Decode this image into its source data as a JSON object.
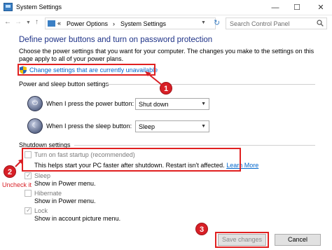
{
  "window": {
    "title": "System Settings",
    "controls": {
      "minimize": "—",
      "maximize": "☐",
      "close": "✕"
    }
  },
  "address": {
    "breadcrumbs": [
      "Power Options",
      "System Settings"
    ],
    "separator": "›",
    "overflow": "«",
    "search_placeholder": "Search Control Panel"
  },
  "main": {
    "heading": "Define power buttons and turn on password protection",
    "intro": "Choose the power settings that you want for your computer. The changes you make to the settings on this page apply to all of your power plans.",
    "change_link": "Change settings that are currently unavailable",
    "power_group": {
      "title": "Power and sleep button settings",
      "rows": [
        {
          "label": "When I press the power button:",
          "value": "Shut down"
        },
        {
          "label": "When I press the sleep button:",
          "value": "Sleep"
        }
      ]
    },
    "shutdown_group": {
      "title": "Shutdown settings",
      "options": [
        {
          "label": "Turn on fast startup (recommended)",
          "desc": "This helps start your PC faster after shutdown. Restart isn't affected.",
          "link": "Learn More",
          "checked": false
        },
        {
          "label": "Sleep",
          "desc": "Show in Power menu.",
          "checked": true
        },
        {
          "label": "Hibernate",
          "desc": "Show in Power menu.",
          "checked": false
        },
        {
          "label": "Lock",
          "desc": "Show in account picture menu.",
          "checked": true
        }
      ]
    }
  },
  "annotations": {
    "badges": [
      "1",
      "2",
      "3"
    ],
    "uncheck_note": "Uncheck it",
    "color": "#d81f26"
  },
  "footer": {
    "save_label": "Save changes",
    "cancel_label": "Cancel"
  }
}
